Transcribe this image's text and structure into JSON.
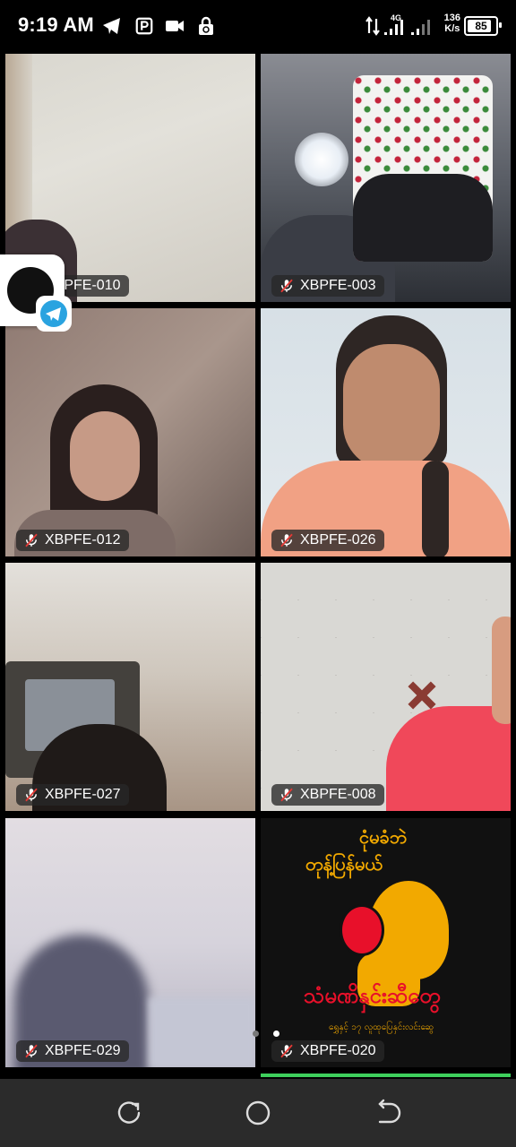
{
  "status_bar": {
    "time": "9:19 AM",
    "network_type": "4G",
    "speed_value": "136",
    "speed_unit": "K/s",
    "battery": "85",
    "icons": [
      "telegram-icon",
      "parking-icon",
      "video-camera-icon",
      "lock-rotation-icon",
      "data-arrows-icon",
      "signal-icon",
      "signal-icon-2",
      "battery-icon"
    ]
  },
  "participants": [
    {
      "label": "XBPFE-010",
      "muted": true
    },
    {
      "label": "XBPFE-003",
      "muted": true
    },
    {
      "label": "XBPFE-012",
      "muted": true
    },
    {
      "label": "XBPFE-026",
      "muted": true
    },
    {
      "label": "XBPFE-027",
      "muted": true
    },
    {
      "label": "XBPFE-008",
      "muted": true
    },
    {
      "label": "XBPFE-029",
      "muted": true
    },
    {
      "label": "XBPFE-020",
      "muted": true
    }
  ],
  "poster": {
    "line1": "ငုံမခံဘဲ",
    "line2": "တုန့်ပြန်မယ်",
    "line3": "သံမဏိနှင်းဆီတွေ",
    "line4": "ရွှေနှင့် ၁၇ လူထုပြေနှင်းလင်းဆွေ"
  },
  "page_indicator": {
    "count": 2,
    "active": 1
  },
  "nav_bar": {
    "icons": [
      "recent-apps-icon",
      "home-icon",
      "back-icon"
    ]
  },
  "colors": {
    "accent_green": "#3ecf5c",
    "badge_bg": "#282828",
    "mic_off_red": "#e53935",
    "telegram_blue": "#2aa3e0"
  }
}
